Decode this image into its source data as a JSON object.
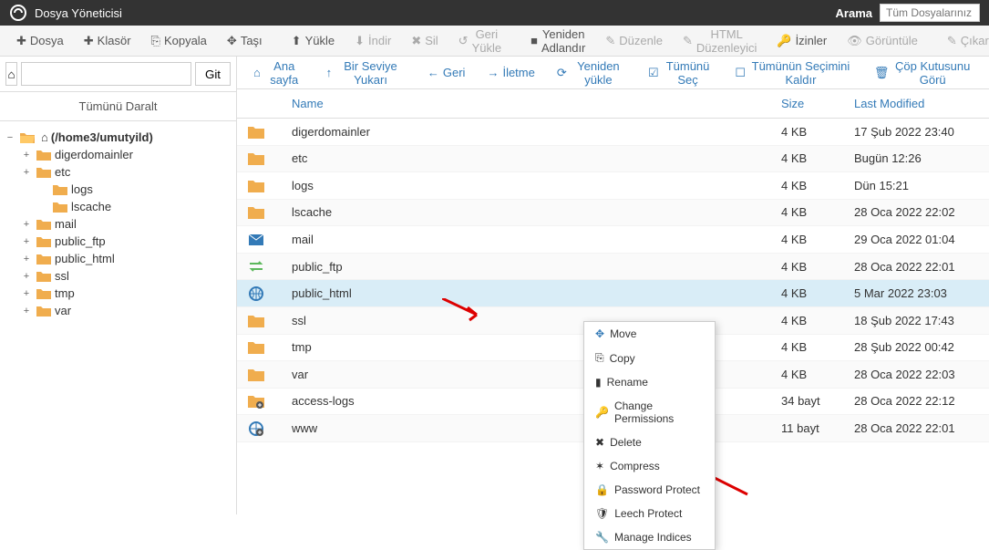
{
  "header": {
    "title": "Dosya Yöneticisi",
    "search_label": "Arama",
    "search_placeholder": "Tüm Dosyalarınız"
  },
  "toolbar": {
    "file": "Dosya",
    "folder": "Klasör",
    "copy": "Kopyala",
    "move": "Taşı",
    "upload": "Yükle",
    "download": "İndir",
    "delete": "Sil",
    "restore": "Geri Yükle",
    "rename": "Yeniden Adlandır",
    "edit": "Düzenle",
    "html_editor": "HTML Düzenleyici",
    "permissions": "İzinler",
    "view": "Görüntüle",
    "extract": "Çıkar"
  },
  "sidebar": {
    "go": "Git",
    "collapse_all": "Tümünü Daralt",
    "root": "(/home3/umutyild)",
    "tree": [
      {
        "name": "digerdomainler",
        "expandable": true
      },
      {
        "name": "etc",
        "expandable": true,
        "children": [
          {
            "name": "logs"
          },
          {
            "name": "lscache"
          }
        ]
      },
      {
        "name": "mail",
        "expandable": true
      },
      {
        "name": "public_ftp",
        "expandable": true
      },
      {
        "name": "public_html",
        "expandable": true
      },
      {
        "name": "ssl",
        "expandable": true
      },
      {
        "name": "tmp",
        "expandable": true
      },
      {
        "name": "var",
        "expandable": true
      }
    ]
  },
  "actions": {
    "home": "Ana sayfa",
    "up": "Bir Seviye Yukarı",
    "back": "Geri",
    "forward": "İletme",
    "reload": "Yeniden yükle",
    "select_all": "Tümünü Seç",
    "deselect_all": "Tümünün Seçimini Kaldır",
    "view_trash": "Çöp Kutusunu Görü"
  },
  "table": {
    "headers": {
      "name": "Name",
      "size": "Size",
      "modified": "Last Modified"
    },
    "rows": [
      {
        "icon": "folder",
        "name": "digerdomainler",
        "size": "4 KB",
        "modified": "17 Şub 2022 23:40"
      },
      {
        "icon": "folder",
        "name": "etc",
        "size": "4 KB",
        "modified": "Bugün 12:26"
      },
      {
        "icon": "folder",
        "name": "logs",
        "size": "4 KB",
        "modified": "Dün 15:21"
      },
      {
        "icon": "folder",
        "name": "lscache",
        "size": "4 KB",
        "modified": "28 Oca 2022 22:02"
      },
      {
        "icon": "mail",
        "name": "mail",
        "size": "4 KB",
        "modified": "29 Oca 2022 01:04"
      },
      {
        "icon": "ftp",
        "name": "public_ftp",
        "size": "4 KB",
        "modified": "28 Oca 2022 22:01"
      },
      {
        "icon": "globe",
        "name": "public_html",
        "size": "4 KB",
        "modified": "5 Mar 2022 23:03",
        "selected": true
      },
      {
        "icon": "folder",
        "name": "ssl",
        "size": "4 KB",
        "modified": "18 Şub 2022 17:43"
      },
      {
        "icon": "folder",
        "name": "tmp",
        "size": "4 KB",
        "modified": "28 Şub 2022 00:42"
      },
      {
        "icon": "folder",
        "name": "var",
        "size": "4 KB",
        "modified": "28 Oca 2022 22:03"
      },
      {
        "icon": "link-folder",
        "name": "access-logs",
        "size": "34 bayt",
        "modified": "28 Oca 2022 22:12"
      },
      {
        "icon": "link-globe",
        "name": "www",
        "size": "11 bayt",
        "modified": "28 Oca 2022 22:01"
      }
    ]
  },
  "context_menu": {
    "move": "Move",
    "copy": "Copy",
    "rename": "Rename",
    "change_perms": "Change Permissions",
    "delete": "Delete",
    "compress": "Compress",
    "password": "Password Protect",
    "leech": "Leech Protect",
    "manage_indices": "Manage Indices"
  }
}
